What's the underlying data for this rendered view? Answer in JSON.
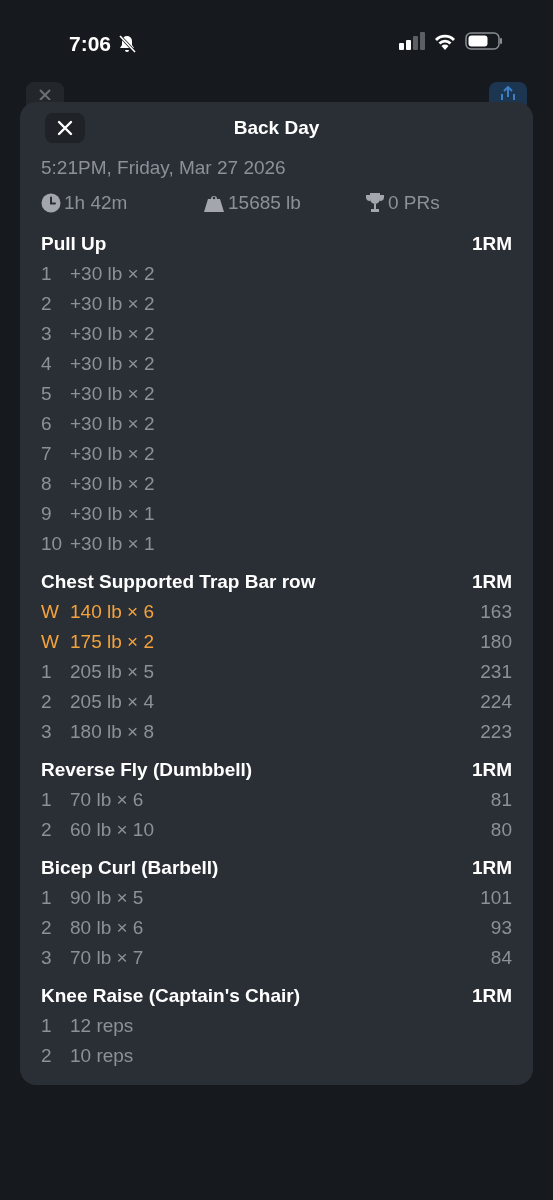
{
  "status_bar": {
    "time": "7:06",
    "silent": true
  },
  "sheet": {
    "title": "Back Day",
    "date": "5:21PM, Friday, Mar 27 2026",
    "stats": [
      {
        "kind": "duration",
        "text": "1h 42m"
      },
      {
        "kind": "volume",
        "text": "15685 lb"
      },
      {
        "kind": "prs",
        "text": "0 PRs"
      }
    ],
    "exercises": [
      {
        "name": "Pull Up",
        "column": "1RM",
        "sets": [
          {
            "kind": "normal",
            "set": "1",
            "weight": "+30 lb × 2"
          },
          {
            "kind": "normal",
            "set": "2",
            "weight": "+30 lb × 2"
          },
          {
            "kind": "normal",
            "set": "3",
            "weight": "+30 lb × 2"
          },
          {
            "kind": "normal",
            "set": "4",
            "weight": "+30 lb × 2"
          },
          {
            "kind": "normal",
            "set": "5",
            "weight": "+30 lb × 2"
          },
          {
            "kind": "normal",
            "set": "6",
            "weight": "+30 lb × 2"
          },
          {
            "kind": "normal",
            "set": "7",
            "weight": "+30 lb × 2"
          },
          {
            "kind": "normal",
            "set": "8",
            "weight": "+30 lb × 2"
          },
          {
            "kind": "normal",
            "set": "9",
            "weight": "+30 lb × 1"
          },
          {
            "kind": "normal",
            "set": "10",
            "weight": "+30 lb × 1"
          }
        ]
      },
      {
        "name": "Chest Supported Trap Bar row",
        "column": "1RM",
        "sets": [
          {
            "kind": "warmup",
            "set": "W",
            "weight": "140 lb × 6",
            "one_rm": "163"
          },
          {
            "kind": "warmup",
            "set": "W",
            "weight": "175 lb × 2",
            "one_rm": "180"
          },
          {
            "kind": "normal",
            "set": "1",
            "weight": "205 lb × 5",
            "one_rm": "231"
          },
          {
            "kind": "normal",
            "set": "2",
            "weight": "205 lb × 4",
            "one_rm": "224"
          },
          {
            "kind": "normal",
            "set": "3",
            "weight": "180 lb × 8",
            "one_rm": "223"
          }
        ]
      },
      {
        "name": "Reverse Fly (Dumbbell)",
        "column": "1RM",
        "sets": [
          {
            "kind": "normal",
            "set": "1",
            "weight": "70 lb × 6",
            "one_rm": "81"
          },
          {
            "kind": "normal",
            "set": "2",
            "weight": "60 lb × 10",
            "one_rm": "80"
          }
        ]
      },
      {
        "name": "Bicep Curl (Barbell)",
        "column": "1RM",
        "sets": [
          {
            "kind": "normal",
            "set": "1",
            "weight": "90 lb × 5",
            "one_rm": "101"
          },
          {
            "kind": "normal",
            "set": "2",
            "weight": "80 lb × 6",
            "one_rm": "93"
          },
          {
            "kind": "normal",
            "set": "3",
            "weight": "70 lb × 7",
            "one_rm": "84"
          }
        ]
      },
      {
        "name": "Knee Raise (Captain's Chair)",
        "column": "1RM",
        "sets": [
          {
            "kind": "normal",
            "set": "1",
            "weight": "12 reps"
          },
          {
            "kind": "normal",
            "set": "2",
            "weight": "10 reps"
          }
        ]
      }
    ]
  }
}
